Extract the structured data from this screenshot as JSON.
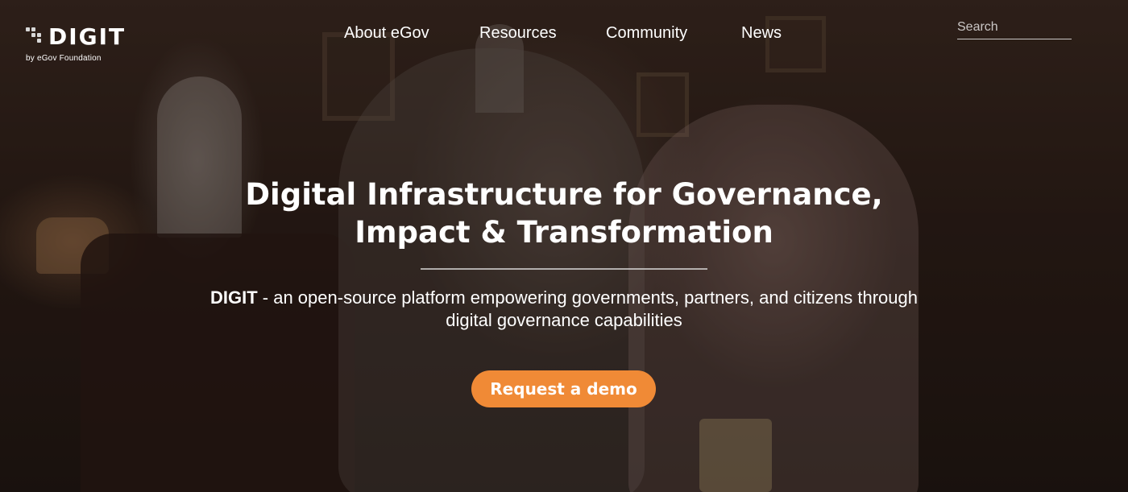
{
  "brand": {
    "name": "DIGIT",
    "tagline": "by eGov Foundation",
    "logo_icon": "digit-dots-logo"
  },
  "nav": {
    "items": [
      {
        "label": "About eGov"
      },
      {
        "label": "Resources"
      },
      {
        "label": "Community"
      },
      {
        "label": "News"
      }
    ]
  },
  "search": {
    "placeholder": "Search",
    "value": ""
  },
  "hero": {
    "headline_line1": "Digital Infrastructure for Governance,",
    "headline_line2": "Impact & Transformation",
    "subtitle_bold": "DIGIT",
    "subtitle_rest": " - an open-source platform empowering governments, partners, and citizens through digital governance capabilities",
    "cta_label": "Request a demo"
  },
  "colors": {
    "cta_background": "#f08a36",
    "text": "#ffffff"
  }
}
